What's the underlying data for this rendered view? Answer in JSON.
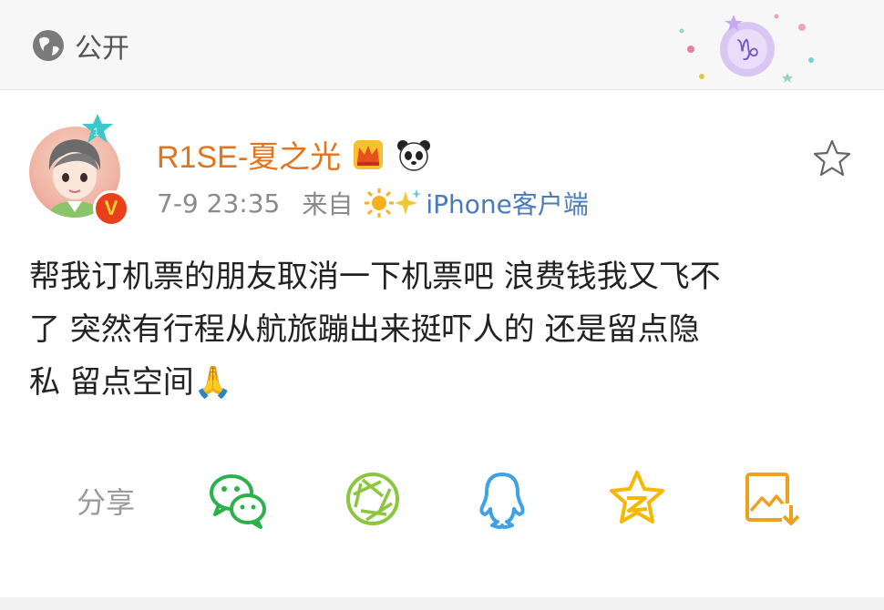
{
  "header": {
    "privacy_label": "公开",
    "privacy_icon": "globe-icon",
    "sticker_icon": "capricorn-sticker-icon"
  },
  "post": {
    "author": {
      "name": "R1SE-夏之光",
      "level_badge": "1",
      "verified_badge": "V",
      "badges": [
        "crown-icon",
        "panda-icon"
      ]
    },
    "time": "7-9 23:35",
    "source_prefix": "来自",
    "source_client": "iPhone客户端",
    "text": "帮我订机票的朋友取消一下机票吧 浪费钱我又飞不\n了 突然有行程从航旅蹦出来挺吓人的 还是留点隐\n私 留点空间🙏"
  },
  "share": {
    "label": "分享",
    "targets": [
      "wechat-icon",
      "moments-icon",
      "qq-icon",
      "qzone-icon",
      "save-image-icon"
    ]
  },
  "colors": {
    "accent_orange": "#e4731a",
    "client_blue": "#4a7ab8",
    "wechat_green": "#2bb24c",
    "moments_green": "#8cc63f",
    "qq_blue": "#3fa1e8",
    "qzone_yellow": "#f5b800",
    "save_orange": "#f0a020"
  }
}
